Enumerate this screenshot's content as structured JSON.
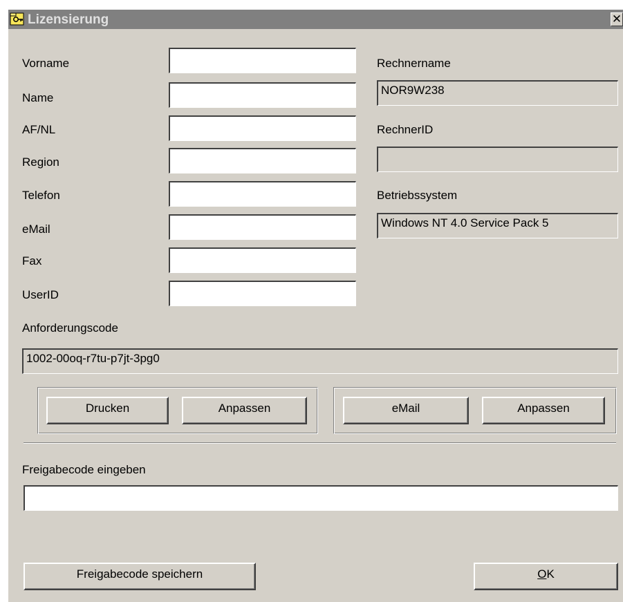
{
  "window": {
    "title": "Lizensierung",
    "close_glyph": "✕"
  },
  "left_fields": [
    {
      "label": "Vorname",
      "value": ""
    },
    {
      "label": "Name",
      "value": ""
    },
    {
      "label": "AF/NL",
      "value": ""
    },
    {
      "label": "Region",
      "value": ""
    },
    {
      "label": "Telefon",
      "value": ""
    },
    {
      "label": "eMail",
      "value": ""
    },
    {
      "label": "Fax",
      "value": ""
    },
    {
      "label": "UserID",
      "value": ""
    }
  ],
  "system": {
    "rechnername_label": "Rechnername",
    "rechnername_value": "NOR9W238",
    "rechnerid_label": "RechnerID",
    "rechnerid_value": "",
    "betriebssystem_label": "Betriebssystem",
    "betriebssystem_value": "Windows NT 4.0 Service Pack 5"
  },
  "request": {
    "label": "Anforderungscode",
    "value": "1002-00oq-r7tu-p7jt-3pg0"
  },
  "buttons": {
    "print": "Drucken",
    "adjust_print": "Anpassen",
    "email": "eMail",
    "adjust_email": "Anpassen",
    "save_release": "Freigabecode speichern",
    "ok_accel": "O",
    "ok_rest": "K"
  },
  "release": {
    "label": "Freigabecode eingeben",
    "value": ""
  },
  "colors": {
    "face": "#d4d0c8",
    "title_inactive": "#808080"
  },
  "icons": {
    "title": "key-folder-icon",
    "close": "close-icon"
  }
}
